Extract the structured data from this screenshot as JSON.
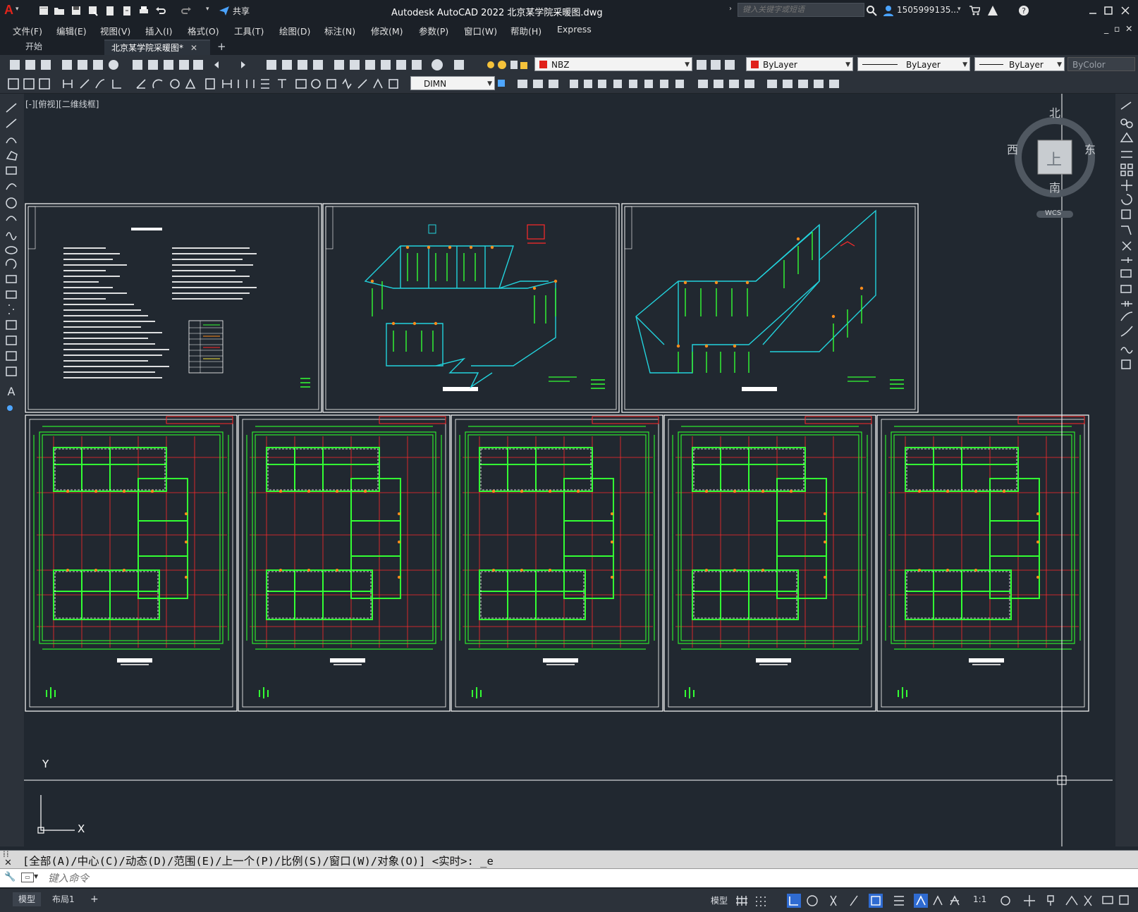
{
  "app": {
    "title": "Autodesk AutoCAD 2022    北京某学院采暖图.dwg",
    "share_label": "共享",
    "search_placeholder": "键入关键字或短语",
    "user_name": "1505999135...",
    "logo": "A"
  },
  "menu": [
    "文件(F)",
    "编辑(E)",
    "视图(V)",
    "插入(I)",
    "格式(O)",
    "工具(T)",
    "绘图(D)",
    "标注(N)",
    "修改(M)",
    "参数(P)",
    "窗口(W)",
    "帮助(H)",
    "Express"
  ],
  "file_tabs": [
    {
      "label": "开始",
      "active": false
    },
    {
      "label": "北京某学院采暖图*",
      "active": true
    }
  ],
  "toolbar": {
    "layer": "NBZ",
    "color": "ByLayer",
    "linetype": "ByLayer",
    "lineweight": "ByLayer",
    "plotstyle": "ByColor",
    "dimstyle": "DIMN",
    "layer_color": "#e0201a",
    "color_swatch": "#e0201a"
  },
  "viewport": {
    "label": "[-][俯视][二维线框]"
  },
  "viewcube": {
    "north": "北",
    "south": "南",
    "east": "东",
    "west": "西",
    "top": "上",
    "wcs": "WCS"
  },
  "ucs": {
    "x": "X",
    "y": "Y"
  },
  "command": {
    "history": "[全部(A)/中心(C)/动态(D)/范围(E)/上一个(P)/比例(S)/窗口(W)/对象(O)] <实时>: _e",
    "placeholder": "键入命令"
  },
  "layout_tabs": [
    {
      "label": "模型",
      "active": true
    },
    {
      "label": "布局1",
      "active": false
    }
  ],
  "status": {
    "model_label": "模型",
    "scale": "1:1"
  }
}
